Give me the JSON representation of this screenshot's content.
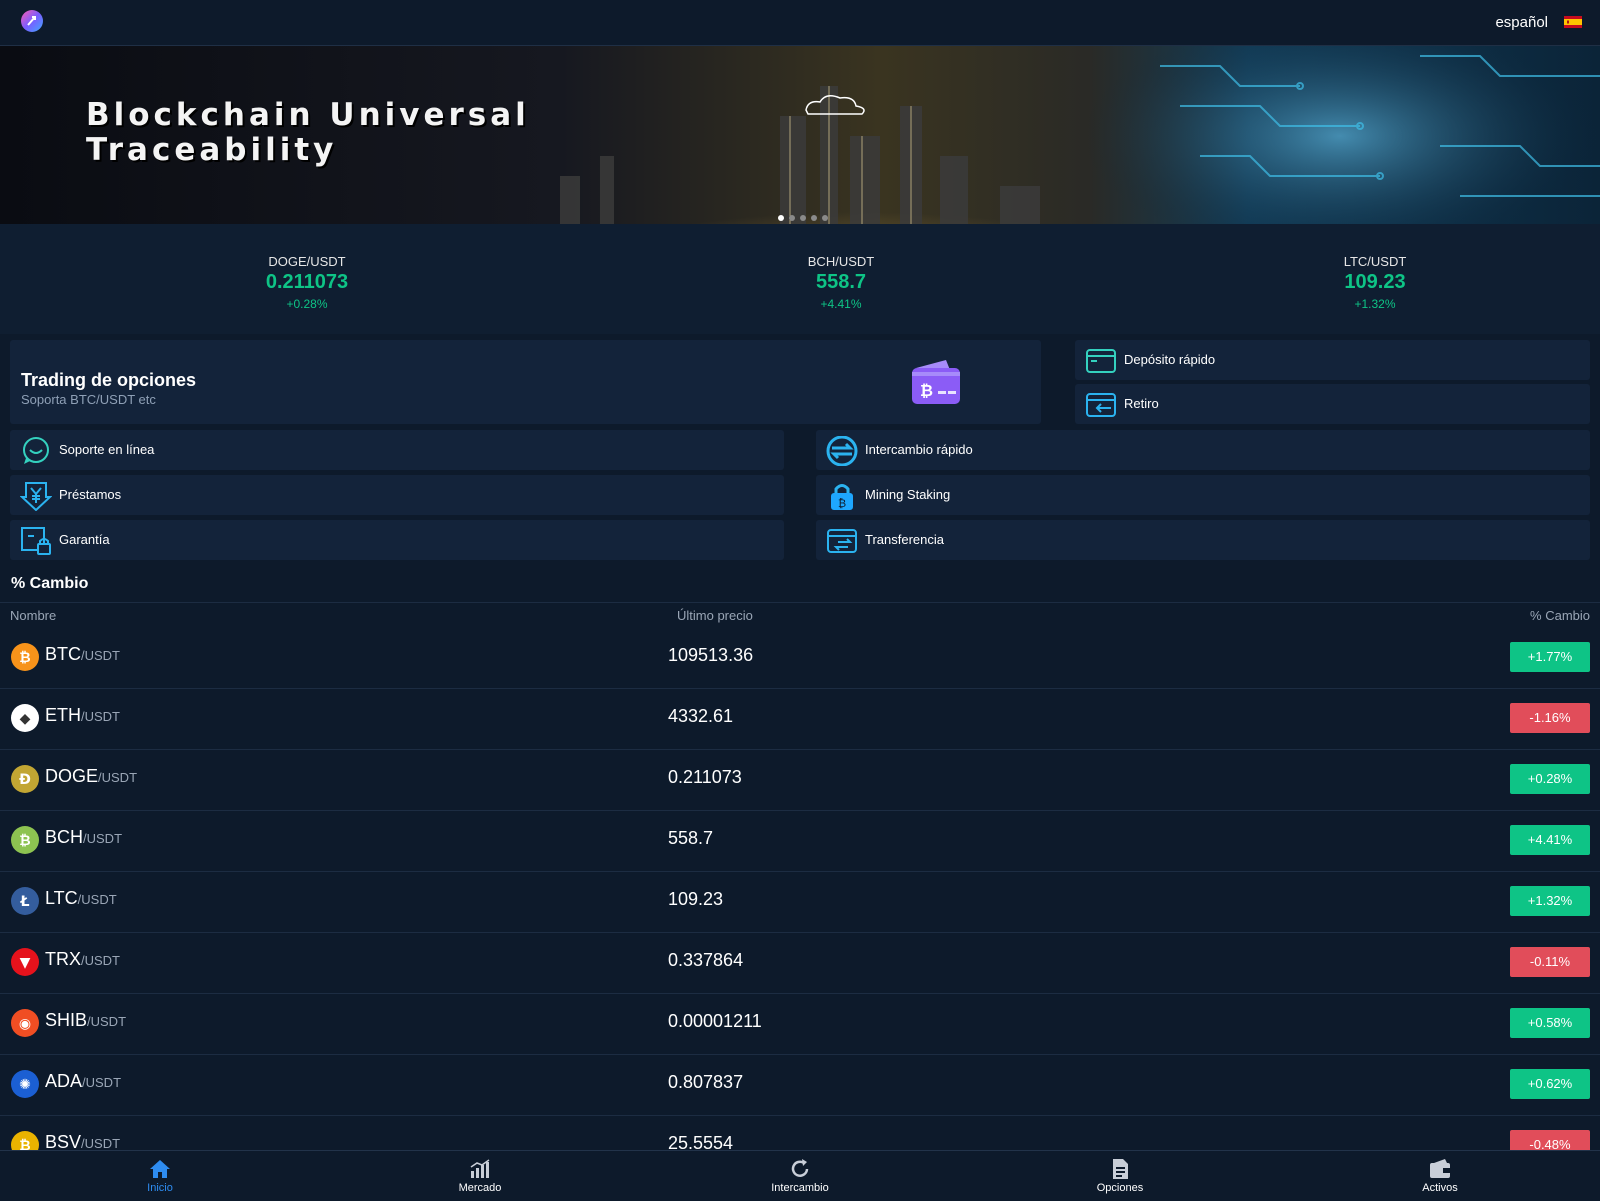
{
  "header": {
    "language": "español",
    "flag_icon": "spain-flag-icon"
  },
  "banner": {
    "title_line1": "Blockchain Universal",
    "title_line2": "Traceability",
    "slides": 5,
    "active_slide": 1
  },
  "tickers": [
    {
      "pair": "DOGE/USDT",
      "price": "0.211073",
      "change": "+0.28%"
    },
    {
      "pair": "BCH/USDT",
      "price": "558.7",
      "change": "+4.41%"
    },
    {
      "pair": "LTC/USDT",
      "price": "109.23",
      "change": "+1.32%"
    }
  ],
  "options_card": {
    "title": "Trading de opciones",
    "subtitle": "Soporta BTC/USDT etc",
    "icon": "bitcoin-wallet-icon"
  },
  "quick_actions": {
    "deposit": "Depósito rápido",
    "withdraw": "Retiro",
    "support": "Soporte en línea",
    "swap": "Intercambio rápido",
    "loans": "Préstamos",
    "staking": "Mining Staking",
    "guarantee": "Garantía",
    "transfer": "Transferencia"
  },
  "market": {
    "section_title": "% Cambio",
    "headers": {
      "name": "Nombre",
      "last_price": "Último precio",
      "change": "% Cambio"
    },
    "quote": "/USDT",
    "rows": [
      {
        "symbol": "BTC",
        "price": "109513.36",
        "change": "+1.77%",
        "color": "#f7931a"
      },
      {
        "symbol": "ETH",
        "price": "4332.61",
        "change": "-1.16%",
        "color": "#ffffff"
      },
      {
        "symbol": "DOGE",
        "price": "0.211073",
        "change": "+0.28%",
        "color": "#c2a633"
      },
      {
        "symbol": "BCH",
        "price": "558.7",
        "change": "+4.41%",
        "color": "#8dc351"
      },
      {
        "symbol": "LTC",
        "price": "109.23",
        "change": "+1.32%",
        "color": "#345d9d"
      },
      {
        "symbol": "TRX",
        "price": "0.337864",
        "change": "-0.11%",
        "color": "#e5121c"
      },
      {
        "symbol": "SHIB",
        "price": "0.00001211",
        "change": "+0.58%",
        "color": "#f04e23"
      },
      {
        "symbol": "ADA",
        "price": "0.807837",
        "change": "+0.62%",
        "color": "#1b5fd3"
      },
      {
        "symbol": "BSV",
        "price": "25.5554",
        "change": "-0.48%",
        "color": "#eab300"
      }
    ]
  },
  "nav": {
    "home": "Inicio",
    "market": "Mercado",
    "exchange": "Intercambio",
    "options": "Opciones",
    "assets": "Activos"
  },
  "colors": {
    "positive": "#0ec486",
    "negative": "#e14d5a",
    "accent": "#2e8cf0",
    "background": "#0d1a2b"
  }
}
